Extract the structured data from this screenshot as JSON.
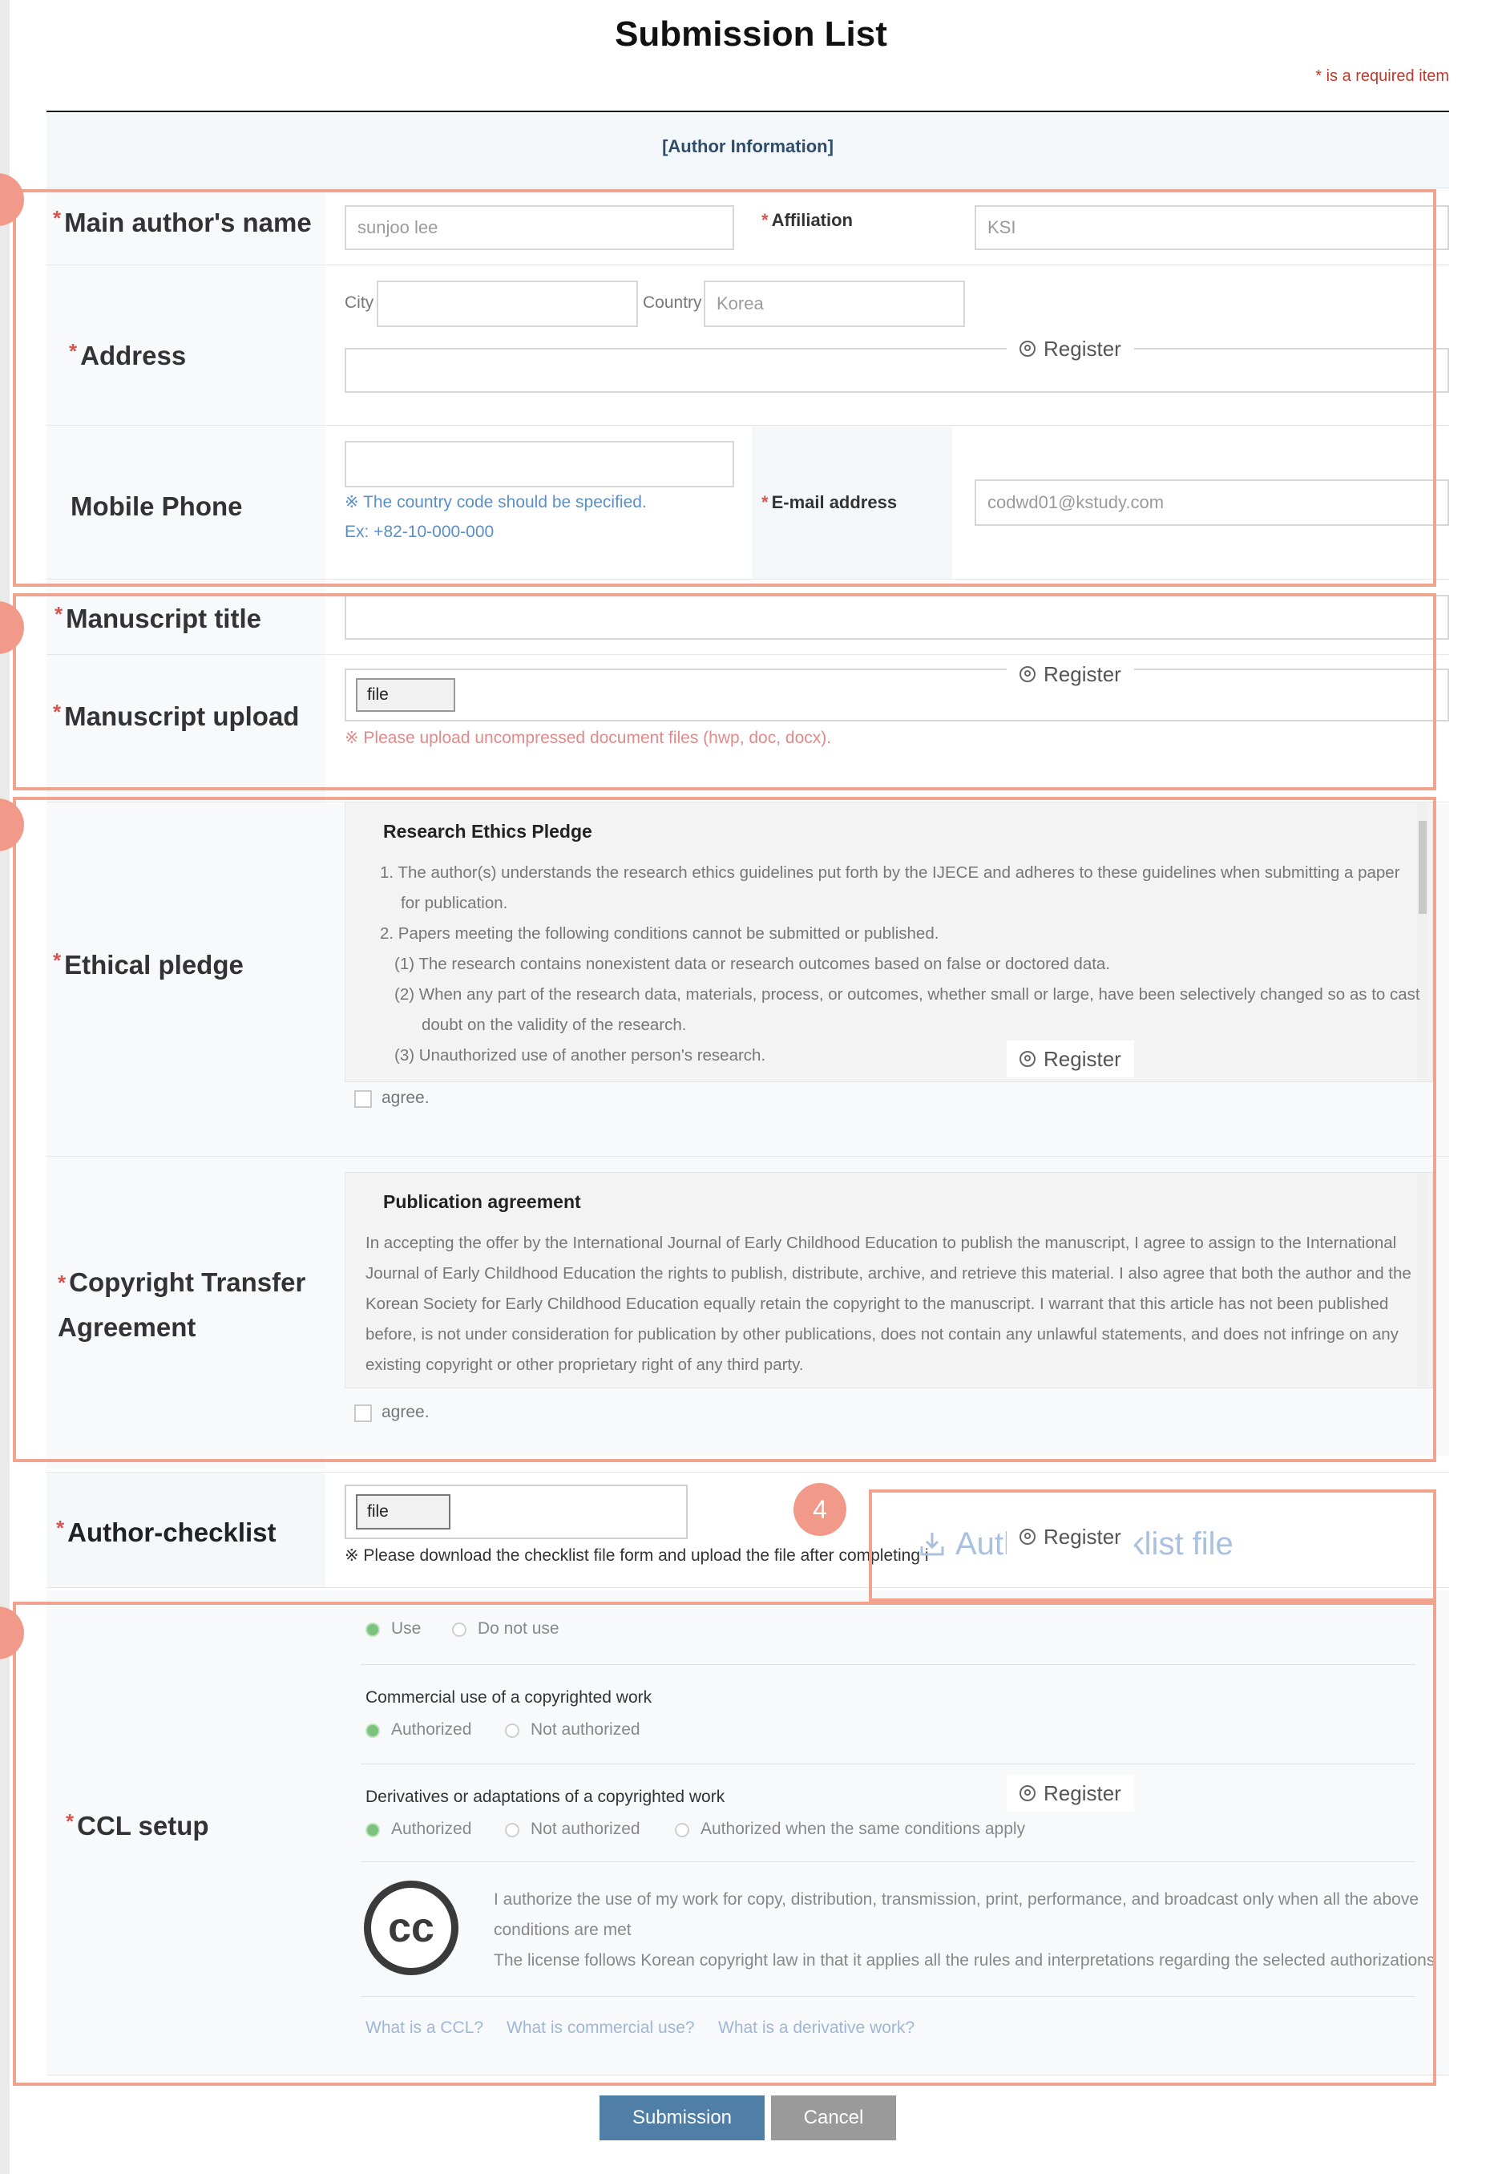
{
  "page": {
    "title": "Submission List",
    "required_note": "* is a required item",
    "section_header": "[Author Information]"
  },
  "labels": {
    "main_author": "Main author's name",
    "affiliation": "Affiliation",
    "address": "Address",
    "mobile_phone": "Mobile Phone",
    "email": "E-mail address",
    "manuscript_title": "Manuscript title",
    "manuscript_upload": "Manuscript upload",
    "ethical_pledge": "Ethical pledge",
    "copyright_line1": "Copyright Transfer",
    "copyright_line2": "Agreement",
    "author_checklist": "Author-checklist",
    "ccl_setup": "CCL setup"
  },
  "fields": {
    "main_author_value": "sunjoo lee",
    "affiliation_value": "KSI",
    "city_label": "City",
    "city_value": "",
    "country_label": "Country",
    "country_value": "Korea",
    "address_detail_value": "",
    "mobile_value": "",
    "mobile_note1": "※ The country code should be specified.",
    "mobile_note2": "Ex: +82-10-000-000",
    "email_value": "codwd01@kstudy.com",
    "manuscript_title_value": "",
    "file_label": "file",
    "upload_note": "※ Please upload uncompressed document files (hwp, doc, docx).",
    "checklist_note": "※ Please download the checklist file form and upload the file after completing i",
    "checklist_download": "Author-checklist file"
  },
  "register_label": "Register",
  "ethics": {
    "heading": "Research Ethics Pledge",
    "lines": [
      "1.  The author(s) understands the research ethics guidelines put forth by the IJECE and adheres to these guidelines when submitting a paper",
      "for publication.",
      "2. Papers meeting the following conditions cannot be submitted or published.",
      "(1)  The research contains nonexistent data or research outcomes based on false or doctored data.",
      "(2)  When any part of the research data, materials, process, or outcomes, whether small or large, have been selectively changed so as to cast",
      "doubt on the validity of the research.",
      "(3)  Unauthorized use of another person's research."
    ],
    "agree": "agree."
  },
  "publication": {
    "heading": "Publication agreement",
    "lines": [
      "In accepting the offer by the International Journal of Early Childhood Education to publish the manuscript, I agree to assign to the International",
      "Journal of Early Childhood Education the rights to publish, distribute, archive, and retrieve this material. I also agree that both the author and the",
      "Korean Society for Early Childhood Education equally retain the copyright to the manuscript. I warrant that this article has not been published",
      "before, is not under consideration for publication by other publications, does not contain any unlawful statements, and does not infringe on any",
      "existing copyright or other proprietary right of any third party."
    ],
    "agree": "agree."
  },
  "ccl": {
    "use": "Use",
    "not_use": "Do not use",
    "commercial_heading": "Commercial use of a copyrighted work",
    "authorized": "Authorized",
    "not_authorized": "Not authorized",
    "derivative_heading": "Derivatives or adaptations of a copyrighted work",
    "same_conditions": "Authorized when the same conditions apply",
    "cc_logo": "cc",
    "statement1": "I authorize the use of my work for copy, distribution, transmission, print, performance, and broadcast only when all the above",
    "statement2": "conditions are met",
    "statement3": "The license follows Korean copyright law in that it applies all the rules and interpretations regarding the selected authorizations",
    "link1": "What is a CCL?",
    "link2": "What is commercial use?",
    "link3": "What is a derivative work?"
  },
  "markers": {
    "m4": "4"
  },
  "buttons": {
    "submit": "Submission",
    "cancel": "Cancel"
  }
}
